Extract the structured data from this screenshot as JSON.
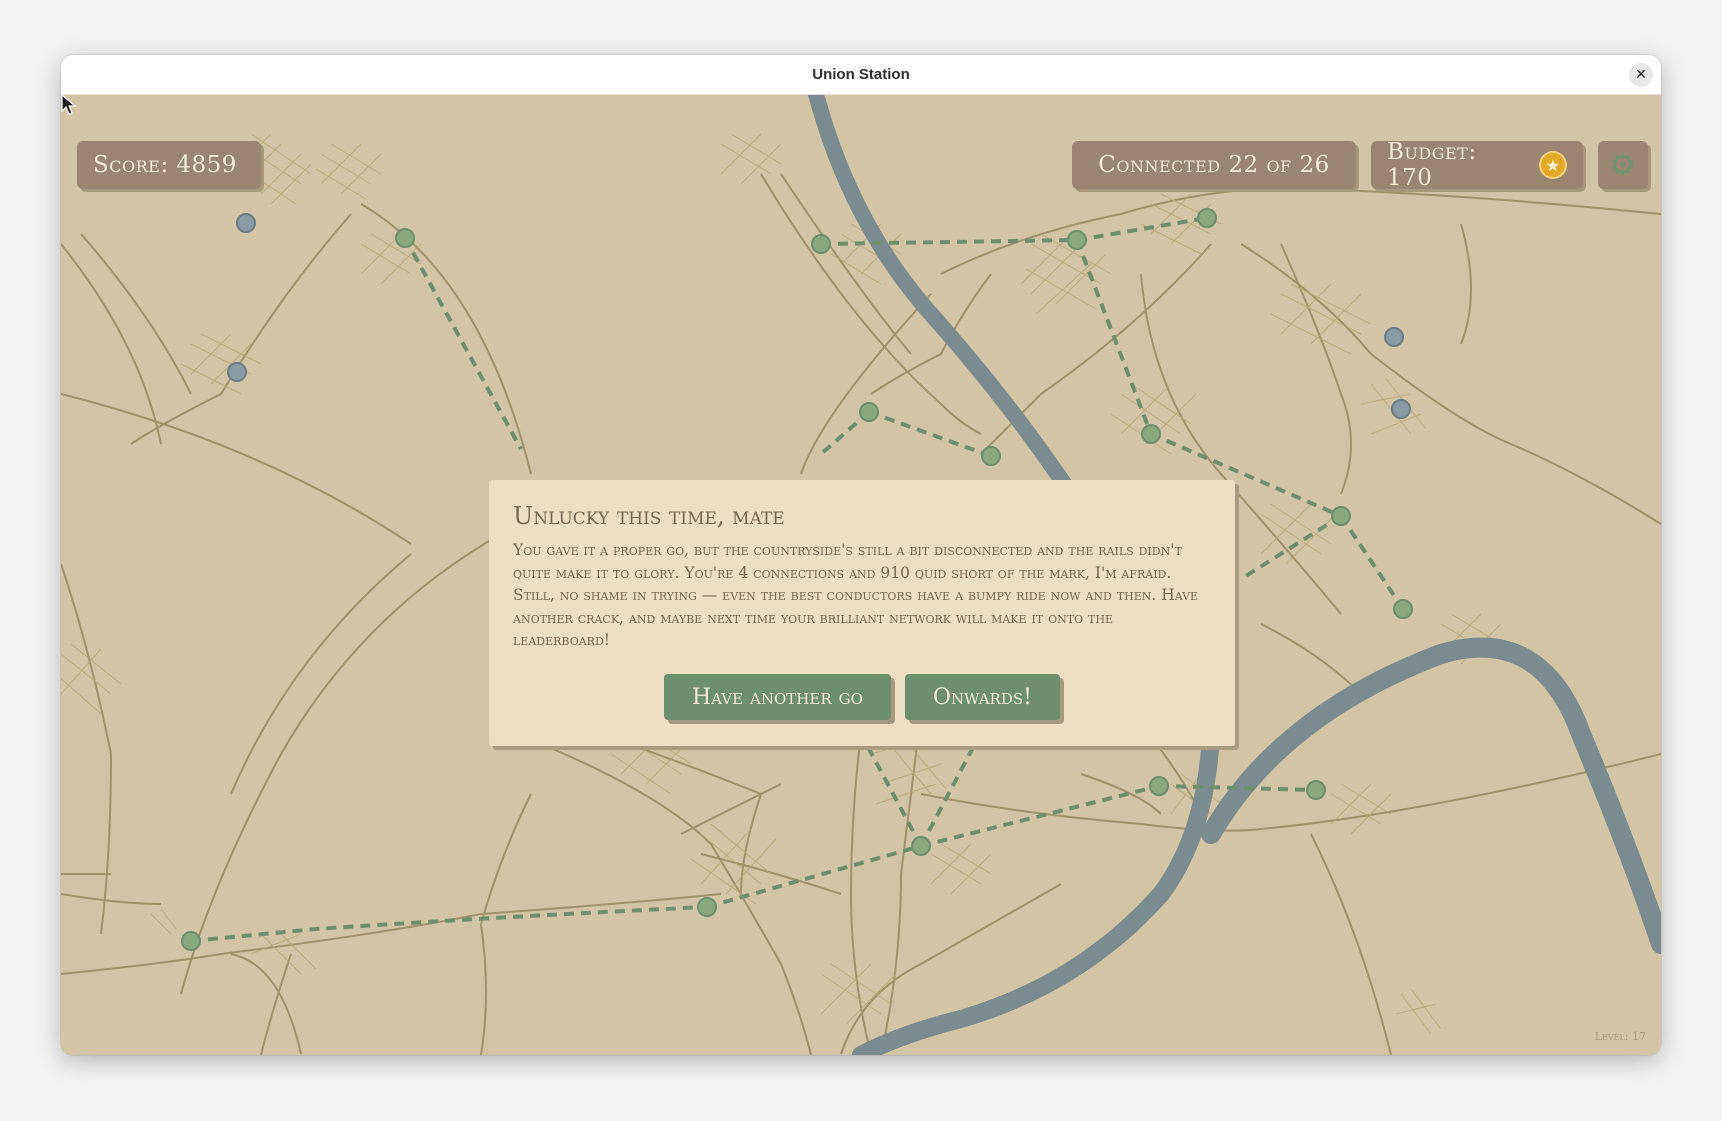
{
  "window": {
    "title": "Union Station",
    "close_icon": "close-icon"
  },
  "hud": {
    "score_label": "Score: 4859",
    "connected_label": "Connected 22 of 26",
    "budget_label": "Budget: 170",
    "coin_icon": "star-coin-icon",
    "settings_icon": "gear-icon"
  },
  "dialog": {
    "title": "Unlucky this time, mate",
    "body": "You gave it a proper go, but the countryside's still a bit disconnected and the rails didn't quite make it to glory. You're 4 connections and 910 quid short of the mark, I'm afraid. Still, no shame in trying — even the best conductors have a bumpy ride now and then. Have another crack, and maybe next time your brilliant network will make it onto the leaderboard!",
    "retry_label": "Have another go",
    "continue_label": "Onwards!"
  },
  "footer": {
    "level_label": "Level: 17"
  },
  "colors": {
    "land": "#d1c5a5",
    "road": "#a0926a",
    "river": "#7b8b8f",
    "rail": "#6f8f6c",
    "station": "#89a97c",
    "town_unconnected": "#8a9ba3",
    "panel": "#ede0c2",
    "hud": "#9a8670",
    "button": "#6d8f6d",
    "coin": "#e4a829"
  }
}
